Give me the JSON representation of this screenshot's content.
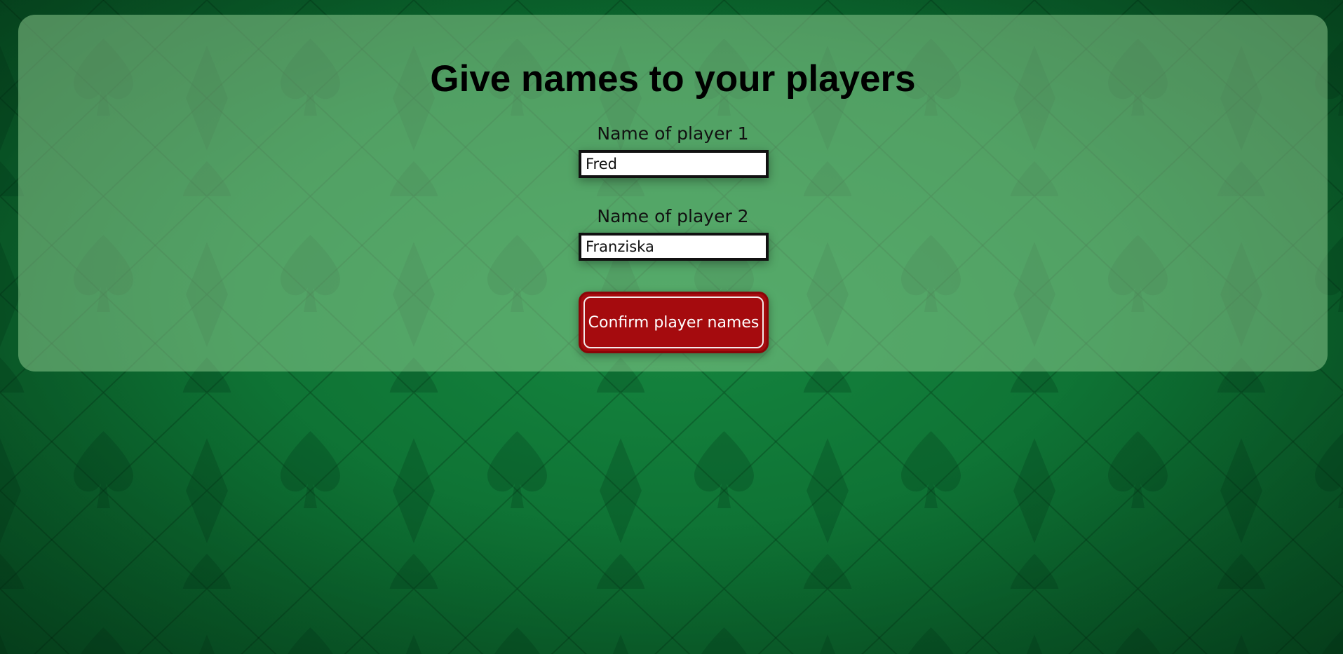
{
  "title": "Give names to your players",
  "players": [
    {
      "label": "Name of player 1",
      "value": "Fred"
    },
    {
      "label": "Name of player 2",
      "value": "Franziska"
    }
  ],
  "confirm_button": {
    "label": "Confirm player names"
  },
  "colors": {
    "table_felt": "#0d6f32",
    "panel_overlay": "#96d296",
    "button": "#a50b0e",
    "suit_symbols": "#0a5a28"
  },
  "background_suits": [
    "spade-icon",
    "club-icon",
    "diamond-icon",
    "heart-icon"
  ]
}
